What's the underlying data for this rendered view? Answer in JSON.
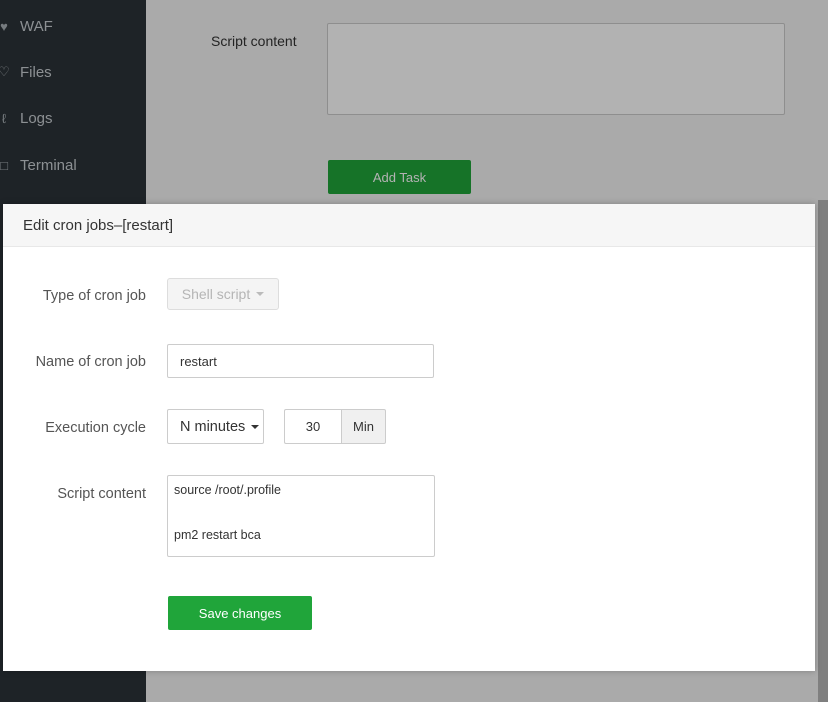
{
  "sidebar": {
    "items": [
      {
        "label": "WAF",
        "icon": "shield-icon"
      },
      {
        "label": "Files",
        "icon": "folder-icon"
      },
      {
        "label": "Logs",
        "icon": "log-icon"
      },
      {
        "label": "Terminal",
        "icon": "terminal-icon"
      }
    ]
  },
  "background_form": {
    "script_label": "Script content",
    "add_task_label": "Add Task"
  },
  "modal": {
    "title": "Edit cron jobs–[restart]",
    "type_label": "Type of cron job",
    "type_value": "Shell script",
    "name_label": "Name of cron job",
    "name_value": "restart",
    "cycle_label": "Execution cycle",
    "cycle_value": "N minutes",
    "minutes_value": "30",
    "minutes_unit": "Min",
    "script_label": "Script content",
    "script_lines": [
      "source /root/.profile",
      "",
      "pm2 restart bca"
    ],
    "save_label": "Save changes"
  },
  "colors": {
    "accent_green": "#20a53a",
    "sidebar_bg": "#2c3338"
  }
}
